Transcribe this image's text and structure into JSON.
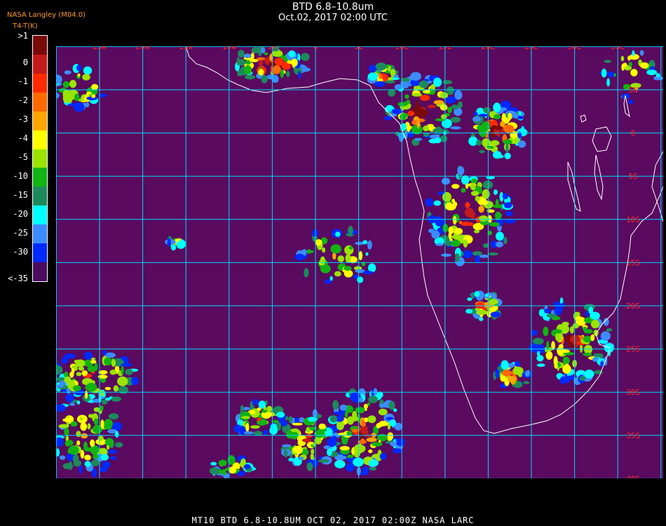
{
  "header": {
    "title": "BTD 6.8–10.8um",
    "subtitle": "Oct.02, 2017 02:00 UTC",
    "source": "NASA Langley (M04.0)",
    "units": "T4-T(K)"
  },
  "legend": {
    "labels": [
      ">1",
      "0",
      "-1",
      "-2",
      "-3",
      "-4",
      "-5",
      "-10",
      "-15",
      "-20",
      "-25",
      "-30",
      "<-35"
    ],
    "colors": [
      "#7a0a0a",
      "#c51a1a",
      "#ff2a00",
      "#ff6a00",
      "#ffa500",
      "#ffff00",
      "#9ae400",
      "#12b312",
      "#1d8a5c",
      "#00ffff",
      "#3c8cff",
      "#0028ff",
      "#4b0b5e"
    ]
  },
  "map": {
    "background_color": "#5a0a5f",
    "grid_color": "#00d8ff",
    "coast_color": "#ffffff",
    "lon_labels": [
      "25W",
      "20W",
      "15W",
      "10W",
      "5W",
      "0",
      "5E",
      "10E",
      "15E",
      "20E",
      "25E",
      "30E",
      "35E"
    ],
    "lat_labels": [
      "5N",
      "0",
      "5S",
      "10S",
      "15S",
      "20S",
      "25S",
      "30S",
      "35S",
      "40S"
    ]
  },
  "footer": "MT10  BTD 6.8-10.8UM   OCT 02, 2017 02:00Z   NASA LARC"
}
